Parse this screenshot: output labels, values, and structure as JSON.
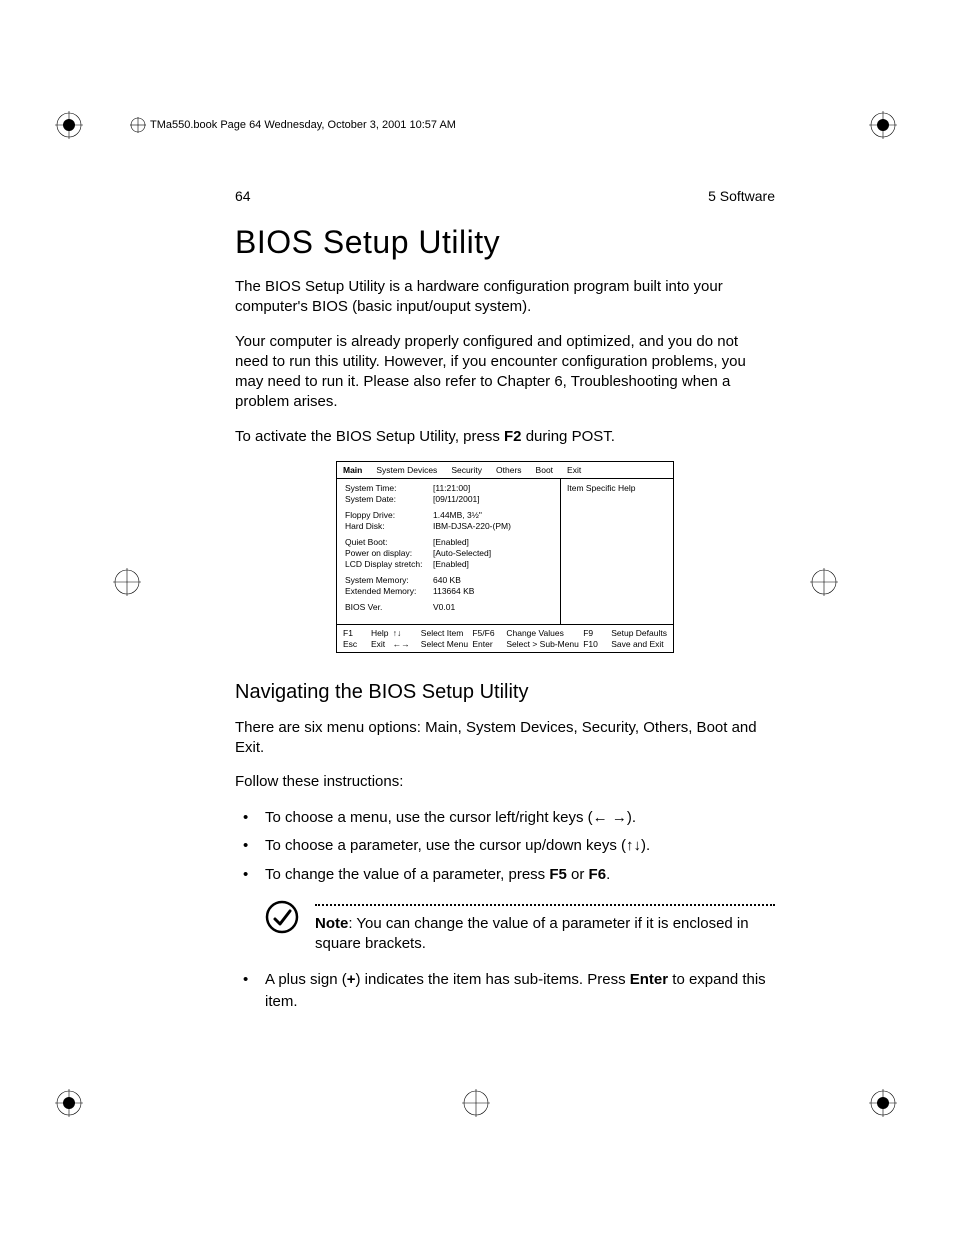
{
  "header": {
    "text": "TMa550.book  Page 64  Wednesday, October 3, 2001  10:57 AM"
  },
  "page_header": {
    "page_num": "64",
    "section": "5 Software"
  },
  "title": "BIOS Setup Utility",
  "para1": "The BIOS Setup Utility is a hardware configuration program built into your computer's BIOS (basic input/ouput system).",
  "para2": "Your computer is already properly configured and optimized, and you do not need to run this utility.  However, if you encounter configuration problems, you may need to run it.  Please also refer to Chapter 6, Troubleshooting when a problem arises.",
  "para3_pre": "To activate the BIOS Setup Utility, press ",
  "para3_bold": "F2",
  "para3_post": " during POST.",
  "bios": {
    "menu": [
      "Main",
      "System Devices",
      "Security",
      "Others",
      "Boot",
      "Exit"
    ],
    "help_title": "Item Specific Help",
    "rows": [
      [
        {
          "lbl": "System Time:",
          "val": "[11:21:00]"
        },
        {
          "lbl": "System Date:",
          "val": "[09/11/2001]"
        }
      ],
      [
        {
          "lbl": "Floppy Drive:",
          "val": "1.44MB, 3½\""
        },
        {
          "lbl": "Hard Disk:",
          "val": "IBM-DJSA-220-(PM)"
        }
      ],
      [
        {
          "lbl": "Quiet Boot:",
          "val": "[Enabled]"
        },
        {
          "lbl": "Power on display:",
          "val": "[Auto-Selected]"
        },
        {
          "lbl": "LCD Display stretch:",
          "val": "[Enabled]"
        }
      ],
      [
        {
          "lbl": "System Memory:",
          "val": "640 KB"
        },
        {
          "lbl": "Extended Memory:",
          "val": "113664 KB"
        }
      ],
      [
        {
          "lbl": "BIOS Ver.",
          "val": "V0.01"
        }
      ]
    ],
    "footer": {
      "c1": [
        {
          "k": "F1",
          "t": "Help"
        },
        {
          "k": "Esc",
          "t": "Exit"
        }
      ],
      "c2": [
        {
          "k": "↑↓",
          "t": "Select Item"
        },
        {
          "k": "←→",
          "t": "Select Menu"
        }
      ],
      "c3": [
        {
          "k": "F5/F6",
          "t": "Change Values"
        },
        {
          "k": "Enter",
          "t": "Select > Sub-Menu"
        }
      ],
      "c4": [
        {
          "k": "F9",
          "t": "Setup Defaults"
        },
        {
          "k": "F10",
          "t": "Save and Exit"
        }
      ]
    }
  },
  "subtitle": "Navigating the BIOS Setup Utility",
  "para4": "There are six menu options: Main, System Devices, Security, Others, Boot and Exit.",
  "para5": "Follow these instructions:",
  "bullets": {
    "b1": "To choose a menu, use the cursor left/right keys  (← →).",
    "b2": "To choose a parameter, use the cursor up/down keys (↑↓).",
    "b3_pre": "To change the value of a parameter, press ",
    "b3_f5": "F5",
    "b3_or": " or ",
    "b3_f6": "F6",
    "b3_post": "."
  },
  "note": {
    "bold": "Note",
    "text": ": You can change the value of a parameter if it is enclosed in square brackets."
  },
  "bullet4": {
    "pre": "A plus sign (",
    "plus": "+",
    "mid": ") indicates the item has sub-items.  Press ",
    "enter": "Enter",
    "post": " to expand this item."
  }
}
